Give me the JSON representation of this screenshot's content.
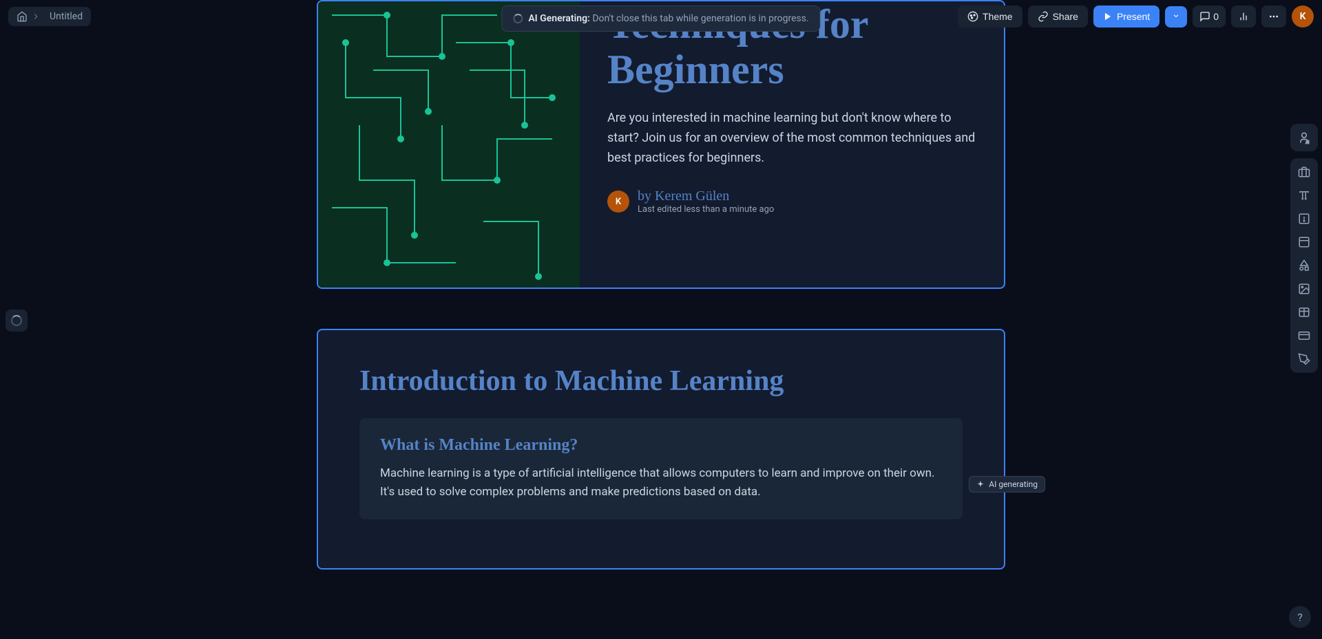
{
  "nav": {
    "document_title": "Untitled"
  },
  "header": {
    "theme_label": "Theme",
    "share_label": "Share",
    "present_label": "Present",
    "comment_count": "0",
    "avatar_initial": "K"
  },
  "notification": {
    "bold_text": "AI Generating:",
    "rest_text": " Don't close this tab while generation is in progress."
  },
  "slide1": {
    "title": "Techniques for Beginners",
    "description": "Are you interested in machine learning but don't know where to start? Join us for an overview of the most common techniques and best practices for beginners.",
    "author_prefix": "by ",
    "author_name": "Kerem Gülen",
    "author_initial": "K",
    "last_edited": "Last edited less than a minute ago"
  },
  "slide2": {
    "title": "Introduction to Machine Learning",
    "card_title": "What is Machine Learning?",
    "card_text": "Machine learning is a type of artificial intelligence that allows computers to learn and improve on their own. It's used to solve complex problems and make predictions based on data."
  },
  "badge": {
    "text": "AI generating"
  },
  "help": {
    "symbol": "?"
  }
}
